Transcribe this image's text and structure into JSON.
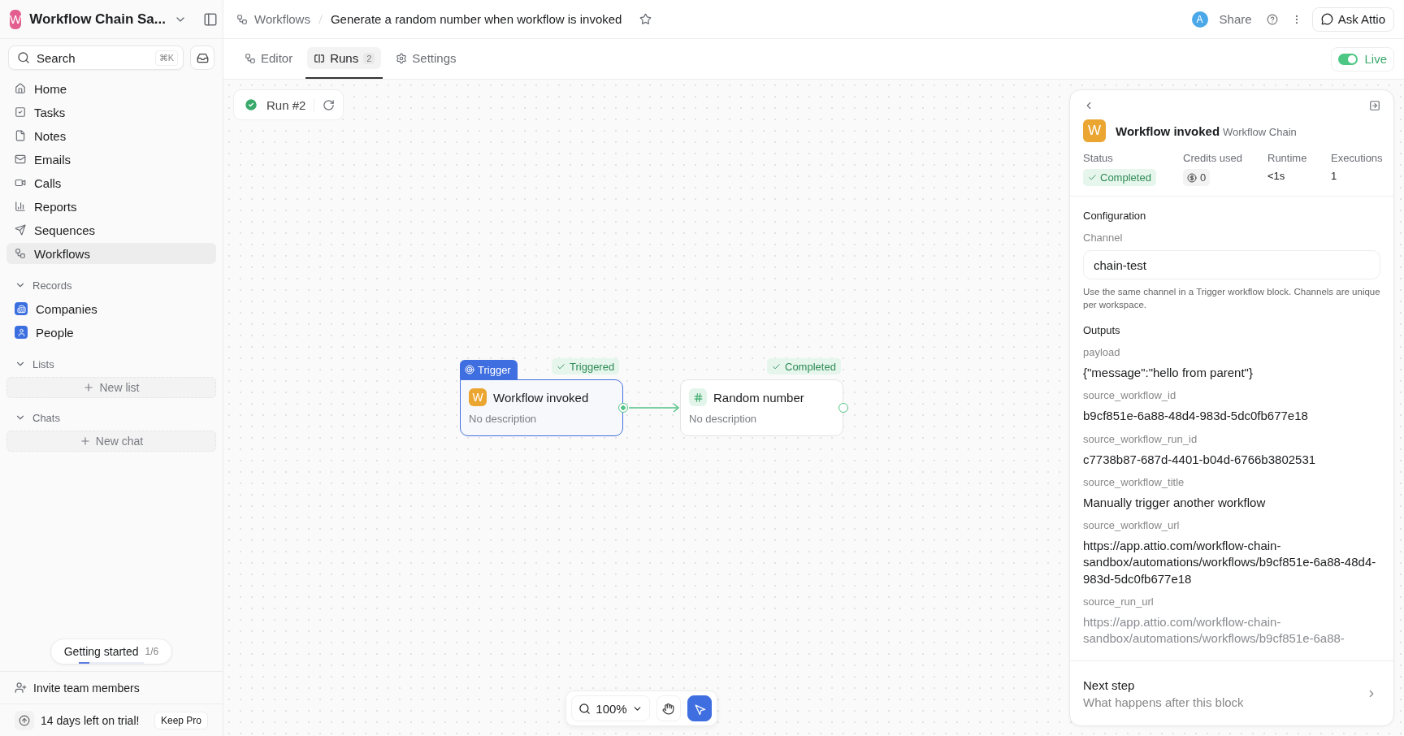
{
  "workspace": {
    "initial": "W",
    "name": "Workflow Chain Sa..."
  },
  "search": {
    "placeholder": "Search",
    "shortcut": "⌘K"
  },
  "nav": [
    {
      "label": "Home",
      "selected": false
    },
    {
      "label": "Tasks",
      "selected": false
    },
    {
      "label": "Notes",
      "selected": false
    },
    {
      "label": "Emails",
      "selected": false
    },
    {
      "label": "Calls",
      "selected": false
    },
    {
      "label": "Reports",
      "selected": false
    },
    {
      "label": "Sequences",
      "selected": false
    },
    {
      "label": "Workflows",
      "selected": true
    }
  ],
  "sections": [
    {
      "title": "Records",
      "items": [
        "Companies",
        "People"
      ]
    },
    {
      "title": "Lists",
      "add": "New list"
    },
    {
      "title": "Chats",
      "add": "New chat"
    }
  ],
  "getting_started": {
    "label": "Getting started",
    "progress": "1/6",
    "level": 0.17
  },
  "invite": "Invite team members",
  "trial": {
    "text": "14 days left on trial!",
    "button": "Keep Pro"
  },
  "breadcrumb": [
    "Workflows",
    "Generate a random number when workflow is invoked"
  ],
  "header": {
    "avatar": "A",
    "share": "Share",
    "ask": "Ask Attio"
  },
  "tabs": [
    {
      "label": "Editor",
      "selected": false
    },
    {
      "label": "Runs",
      "count": "2",
      "selected": true
    },
    {
      "label": "Settings",
      "selected": false
    }
  ],
  "live": {
    "label": "Live",
    "on": true
  },
  "run": {
    "label": "Run #2"
  },
  "nodes": [
    {
      "kind": "trigger",
      "icon": "W",
      "tag": "Trigger",
      "status": "Triggered",
      "title": "Workflow invoked",
      "description": "No description",
      "selected": true
    },
    {
      "kind": "number",
      "status": "Completed",
      "title": "Random number",
      "description": "No description",
      "selected": false
    }
  ],
  "zoom": "100%",
  "panel": {
    "icon": "W",
    "title": "Workflow invoked",
    "subtitle": "Workflow Chain",
    "stats": [
      {
        "kind": "status",
        "label": "Status",
        "value": "Completed"
      },
      {
        "kind": "credits",
        "label": "Credits used",
        "value": "0"
      },
      {
        "kind": "text",
        "label": "Runtime",
        "value": "<1s"
      },
      {
        "kind": "text",
        "label": "Executions",
        "value": "1"
      }
    ],
    "configuration": {
      "heading": "Configuration",
      "field_label": "Channel",
      "value": "chain-test",
      "help": "Use the same channel in a Trigger workflow block. Channels are unique per workspace."
    },
    "outputs": {
      "heading": "Outputs",
      "items": [
        {
          "key": "payload",
          "value": "{\"message\":\"hello from parent\"}"
        },
        {
          "key": "source_workflow_id",
          "value": "b9cf851e-6a88-48d4-983d-5dc0fb677e18"
        },
        {
          "key": "source_workflow_run_id",
          "value": "c7738b87-687d-4401-b04d-6766b3802531"
        },
        {
          "key": "source_workflow_title",
          "value": "Manually trigger another workflow"
        },
        {
          "key": "source_workflow_url",
          "value": "https://app.attio.com/workflow-chain-sandbox/automations/workflows/b9cf851e-6a88-48d4-983d-5dc0fb677e18"
        },
        {
          "key": "source_run_url",
          "value": "https://app.attio.com/workflow-chain-sandbox/automations/workflows/b9cf851e-6a88-",
          "faded": true
        }
      ]
    },
    "next": {
      "title": "Next step",
      "subtitle": "What happens after this block"
    }
  }
}
